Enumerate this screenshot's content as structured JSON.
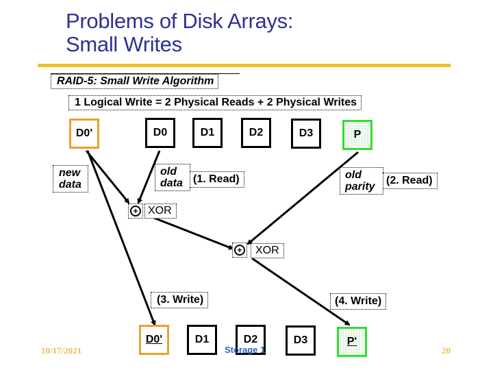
{
  "slide": {
    "title_line1": "Problems of Disk Arrays:",
    "title_line2": "Small Writes",
    "subtitle": "RAID-5: Small Write Algorithm",
    "equation": "1 Logical Write = 2 Physical Reads + 2  Physical Writes"
  },
  "colors": {
    "title": "#2e3192",
    "rule": "#f0c020",
    "new_data_border": "#e8a030",
    "parity_border": "#33dd33",
    "footer_date": "#e8c050",
    "footer_center": "#3060c0"
  },
  "top_row": {
    "new_block": "D0'",
    "disks": [
      "D0",
      "D1",
      "D2",
      "D3"
    ],
    "parity": "P"
  },
  "bottom_row": {
    "new_block": "D0'",
    "disks": [
      "D1",
      "D2",
      "D3"
    ],
    "parity": "P'"
  },
  "labels": {
    "new_data_1": "new",
    "new_data_2": "data",
    "old_data_1": "old",
    "old_data_2": "data",
    "read1": "(1. Read)",
    "old_parity_1": "old",
    "old_parity_2": "parity",
    "read2": "(2. Read)",
    "xor1": "XOR",
    "xor2": "XOR",
    "xor_symbol": "+",
    "write3": "(3. Write)",
    "write4": "(4. Write)"
  },
  "footer": {
    "date": "10/17/2021",
    "center": "Storage 1",
    "page": "20"
  }
}
